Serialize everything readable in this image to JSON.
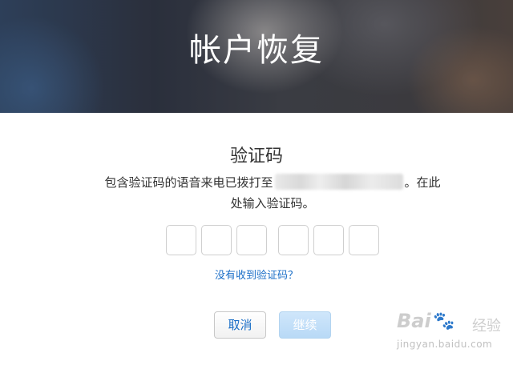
{
  "header": {
    "title": "帐户恢复"
  },
  "verification": {
    "title": "验证码",
    "description_prefix": "包含验证码的语音来电已拨打至",
    "description_suffix": "。在此",
    "description_line2": "处输入验证码。",
    "code_digit_count": 6,
    "resend_link": "没有收到验证码？"
  },
  "actions": {
    "cancel_label": "取消",
    "continue_label": "继续"
  },
  "watermark": {
    "brand": "Bai",
    "brand_suffix": "经验",
    "url": "jingyan.baidu.com"
  },
  "colors": {
    "link": "#1a6ec7",
    "continue_disabled": "#b8d9f6"
  }
}
